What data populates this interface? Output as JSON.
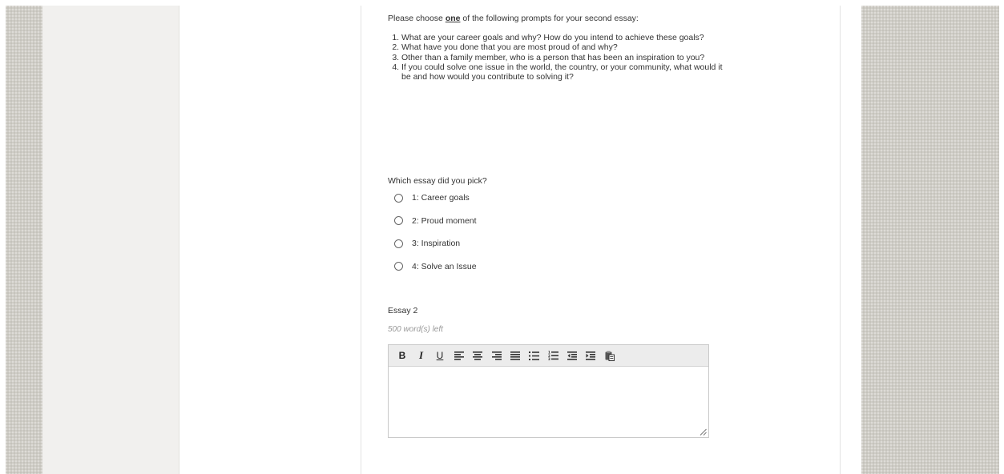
{
  "instructions": {
    "before": "Please choose ",
    "emphasis": "one",
    "after": " of the following prompts for your second essay:"
  },
  "prompts": [
    "What are your career goals and why? How do you intend to achieve these goals?",
    "What have you done that you are most proud of and why?",
    "Other than a family member, who is a person that has been an inspiration to you?",
    "If you could solve one issue in the world, the country, or your community, what would it be and how would you contribute to solving it?"
  ],
  "question": "Which essay did you pick?",
  "options": [
    {
      "label": "1: Career goals"
    },
    {
      "label": "2: Proud moment"
    },
    {
      "label": "3: Inspiration"
    },
    {
      "label": "4: Solve an Issue"
    }
  ],
  "essay": {
    "label": "Essay 2",
    "words_left": "500 word(s) left",
    "value": ""
  },
  "toolbar": {
    "bold": "B",
    "italic": "I",
    "underline": "U"
  },
  "colors": {
    "background_pattern": "#cfcdc6",
    "side_panel": "#f1f0ee",
    "toolbar_bg": "#ececec",
    "text": "#333333"
  }
}
